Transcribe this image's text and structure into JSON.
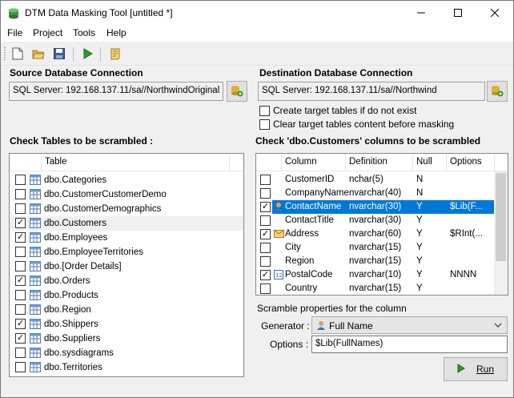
{
  "window": {
    "title": "DTM Data Masking Tool [untitled *]"
  },
  "menu": [
    "File",
    "Project",
    "Tools",
    "Help"
  ],
  "toolbar": {
    "buttons": [
      "new-icon",
      "open-icon",
      "save-icon",
      "run-icon",
      "script-icon"
    ]
  },
  "source": {
    "label": "Source Database Connection",
    "value": "SQL Server: 192.168.137.11/sa//NorthwindOriginal"
  },
  "destination": {
    "label": "Destination Database Connection",
    "value": "SQL Server: 192.168.137.11/sa//Northwind",
    "create_tables": "Create target tables if do not exist",
    "clear_tables": "Clear target tables content before masking"
  },
  "tables": {
    "label": "Check Tables to be scrambled :",
    "header": "Table",
    "items": [
      {
        "name": "dbo.Categories",
        "checked": false
      },
      {
        "name": "dbo.CustomerCustomerDemo",
        "checked": false
      },
      {
        "name": "dbo.CustomerDemographics",
        "checked": false
      },
      {
        "name": "dbo.Customers",
        "checked": true,
        "selected": true
      },
      {
        "name": "dbo.Employees",
        "checked": true
      },
      {
        "name": "dbo.EmployeeTerritories",
        "checked": false
      },
      {
        "name": "dbo.[Order Details]",
        "checked": false
      },
      {
        "name": "dbo.Orders",
        "checked": true
      },
      {
        "name": "dbo.Products",
        "checked": false
      },
      {
        "name": "dbo.Region",
        "checked": false
      },
      {
        "name": "dbo.Shippers",
        "checked": true
      },
      {
        "name": "dbo.Suppliers",
        "checked": true
      },
      {
        "name": "dbo.sysdiagrams",
        "checked": false
      },
      {
        "name": "dbo.Territories",
        "checked": false
      }
    ]
  },
  "columns": {
    "label": "Check 'dbo.Customers' columns to be scrambled",
    "headers": [
      "Column",
      "Definition",
      "Null",
      "Options"
    ],
    "rows": [
      {
        "column": "CustomerID",
        "definition": "nchar(5)",
        "null": "N",
        "options": "",
        "checked": false,
        "icon": ""
      },
      {
        "column": "CompanyName",
        "definition": "nvarchar(40)",
        "null": "N",
        "options": "",
        "checked": false,
        "icon": ""
      },
      {
        "column": "ContactName",
        "definition": "nvarchar(30)",
        "null": "Y",
        "options": "$Lib(F...",
        "checked": true,
        "icon": "person-icon",
        "selected": true
      },
      {
        "column": "ContactTitle",
        "definition": "nvarchar(30)",
        "null": "Y",
        "options": "",
        "checked": false,
        "icon": ""
      },
      {
        "column": "Address",
        "definition": "nvarchar(60)",
        "null": "Y",
        "options": "$RInt(...",
        "checked": true,
        "icon": "envelope-icon"
      },
      {
        "column": "City",
        "definition": "nvarchar(15)",
        "null": "Y",
        "options": "",
        "checked": false,
        "icon": ""
      },
      {
        "column": "Region",
        "definition": "nvarchar(15)",
        "null": "Y",
        "options": "",
        "checked": false,
        "icon": ""
      },
      {
        "column": "PostalCode",
        "definition": "nvarchar(10)",
        "null": "Y",
        "options": "NNNN",
        "checked": true,
        "icon": "number-icon"
      },
      {
        "column": "Country",
        "definition": "nvarchar(15)",
        "null": "Y",
        "options": "",
        "checked": false,
        "icon": ""
      }
    ]
  },
  "scramble": {
    "label": "Scramble properties for the column",
    "generator_label": "Generator :",
    "generator_value": "Full Name",
    "options_label": "Options :",
    "options_value": "$Lib(FullNames)"
  },
  "run": {
    "label": "Run"
  },
  "colors": {
    "selection": "#0078d7",
    "accent": "#2a8f2a"
  }
}
